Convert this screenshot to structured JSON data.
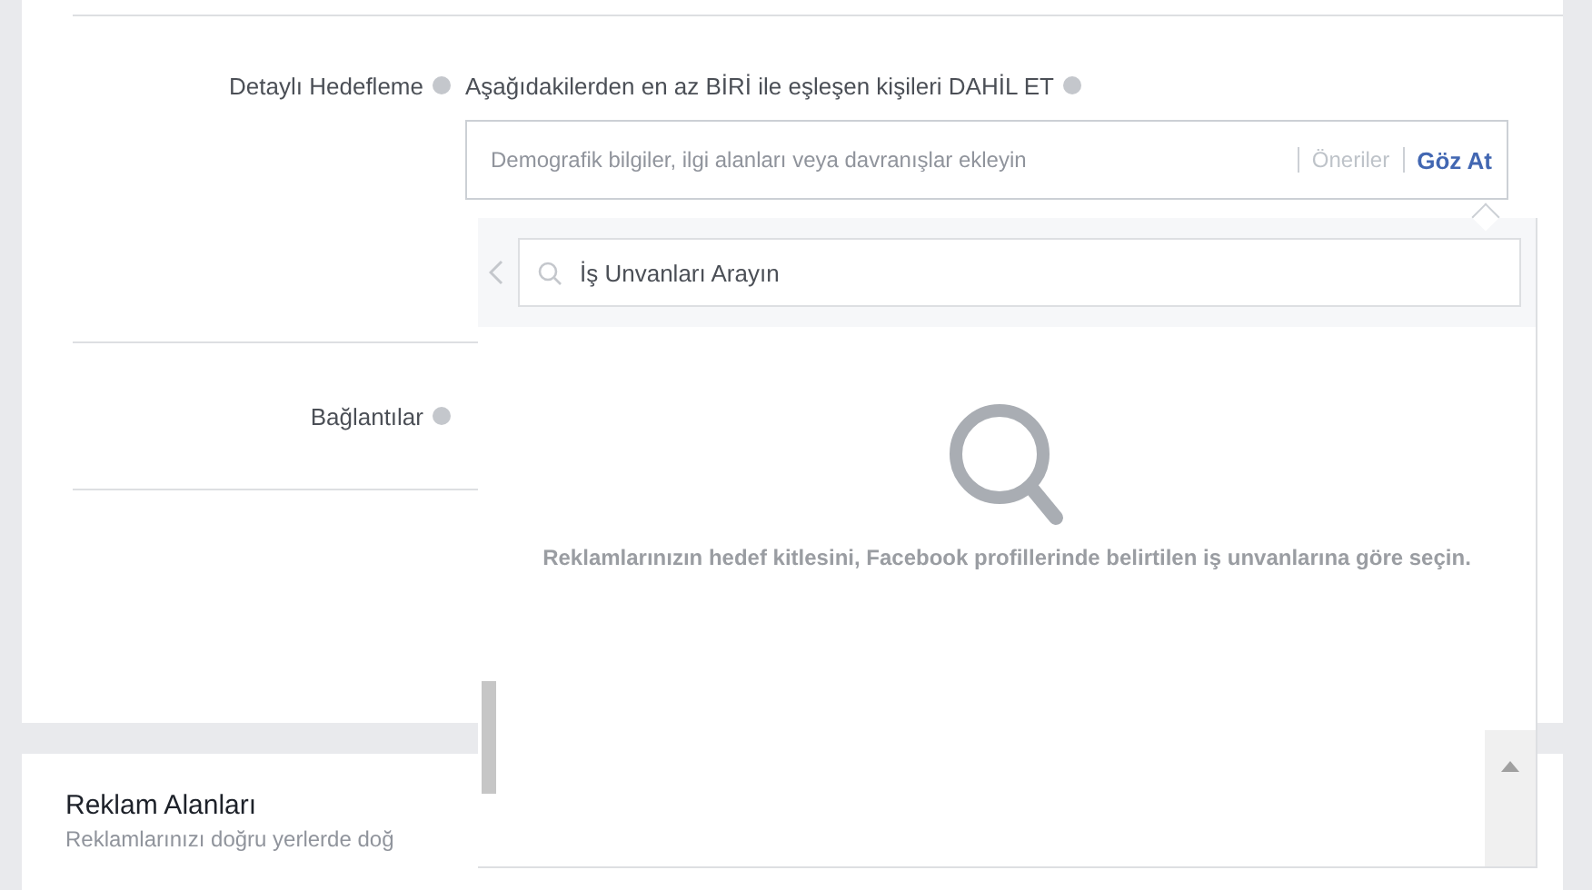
{
  "detailed_targeting": {
    "label": "Detaylı Hedefleme",
    "include_text": "Aşağıdakilerden en az BİRİ ile eşleşen kişileri DAHİL ET",
    "placeholder": "Demografik bilgiler, ilgi alanları veya davranışlar ekleyin",
    "tabs": [
      {
        "label": "Öneriler",
        "selected": false
      },
      {
        "label": "Göz At",
        "selected": true
      }
    ]
  },
  "popup": {
    "search_placeholder": "İş Unvanları Arayın",
    "empty_message": "Reklamlarınızın hedef kitlesini, Facebook profillerinde belirtilen iş unvanlarına göre seçin."
  },
  "connections": {
    "label": "Bağlantılar"
  },
  "placements": {
    "title": "Reklam Alanları",
    "subtitle": "Reklamlarınızı doğru yerlerde doğ"
  }
}
